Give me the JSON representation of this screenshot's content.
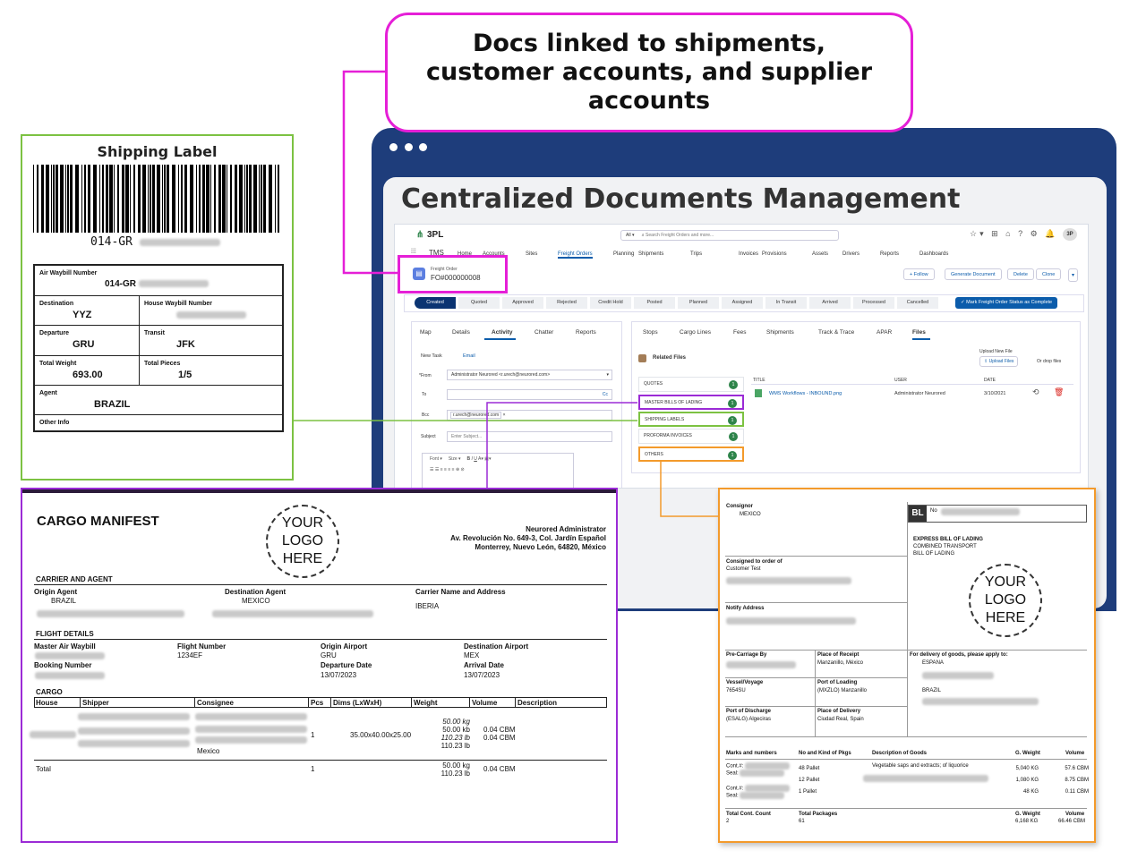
{
  "callout": {
    "text": "Docs linked to shipments, customer accounts, and supplier accounts"
  },
  "main_title": "Centralized Documents Management",
  "app": {
    "brand": "3PL",
    "search_scope": "All",
    "search_placeholder": "Search Freight Orders and more...",
    "nav_app": "TMS",
    "nav": [
      "Home",
      "Accounts",
      "Sites",
      "Freight Orders",
      "Planning",
      "Shipments",
      "Trips",
      "Invoices",
      "Provisions",
      "Assets",
      "Drivers",
      "Reports",
      "Dashboards"
    ],
    "record_type": "Freight Order",
    "record_id": "FO#000000008",
    "actions": [
      "+ Follow",
      "Generate Document",
      "Delete",
      "Clone"
    ],
    "stages": [
      "Created",
      "Quoted",
      "Approved",
      "Rejected",
      "Credit Hold",
      "Posted",
      "Planned",
      "Assigned",
      "In Transit",
      "Arrived",
      "Processed",
      "Cancelled"
    ],
    "complete_button": "Mark Freight Order Status as Complete",
    "left_tabs": [
      "Map",
      "Details",
      "Activity",
      "Chatter",
      "Reports"
    ],
    "sub_tabs": [
      "New Task",
      "Email"
    ],
    "email": {
      "from_label": "From",
      "from_value": "Administrator Neurored <r.urech@neurored.com>",
      "to_label": "To",
      "cc": "Cc",
      "bcc_label": "Bcc",
      "bcc_value": "r.urech@neurored.com",
      "subject_label": "Subject",
      "subject_placeholder": "Enter Subject...",
      "font": "Font",
      "size": "Size"
    },
    "right_tabs": [
      "Stops",
      "Cargo Lines",
      "Fees",
      "Shipments",
      "Track & Trace",
      "APAR",
      "Files"
    ],
    "related_files": "Related Files",
    "upload_label": "Upload New File",
    "upload_button": "Upload Files",
    "drop_text": "Or drop files",
    "folders": [
      {
        "name": "QUOTES",
        "count": "1"
      },
      {
        "name": "MASTER BILLS OF LADING",
        "count": "1"
      },
      {
        "name": "SHIPPING LABELS",
        "count": "1"
      },
      {
        "name": "PROFORMA INVOICES",
        "count": "1"
      },
      {
        "name": "OTHERS",
        "count": "1"
      }
    ],
    "file_headers": [
      "TITLE",
      "USER",
      "DATE"
    ],
    "file_row": {
      "title": "WMS Workflows - INBOUND.png",
      "user": "Administrator Neurored",
      "date": "3/10/2021"
    }
  },
  "shipping_label": {
    "title": "Shipping Label",
    "barcode_text": "014-GR",
    "awb_label": "Air Waybill Number",
    "awb_value": "014-GR",
    "dest_label": "Destination",
    "dest_value": "YYZ",
    "hawb_label": "House Waybill Number",
    "dep_label": "Departure",
    "dep_value": "GRU",
    "transit_label": "Transit",
    "transit_value": "JFK",
    "weight_label": "Total Weight",
    "weight_value": "693.00",
    "pieces_label": "Total Pieces",
    "pieces_value": "1/5",
    "agent_label": "Agent",
    "agent_value": "BRAZIL",
    "other_label": "Other Info"
  },
  "manifest": {
    "title": "CARGO MANIFEST",
    "logo": "YOUR LOGO HERE",
    "company": "Neurored Administrator",
    "address1": "Av. Revolución No. 649-3, Col. Jardín Español",
    "address2": "Monterrey, Nuevo León, 64820, México",
    "carrier_section": "CARRIER AND AGENT",
    "origin_agent_label": "Origin Agent",
    "origin_agent_value": "BRAZIL",
    "dest_agent_label": "Destination Agent",
    "dest_agent_value": "MEXICO",
    "carrier_label": "Carrier Name and Address",
    "carrier_value": "IBERIA",
    "flight_section": "FLIGHT DETAILS",
    "maw_label": "Master Air Waybill",
    "flight_label": "Flight Number",
    "flight_value": "1234EF",
    "origin_airport_label": "Origin Airport",
    "origin_airport_value": "GRU",
    "dest_airport_label": "Destination Airport",
    "dest_airport_value": "MEX",
    "booking_label": "Booking Number",
    "dep_date_label": "Departure Date",
    "dep_date_value": "13/07/2023",
    "arr_date_label": "Arrival Date",
    "arr_date_value": "13/07/2023",
    "cargo_section": "CARGO",
    "cargo_headers": [
      "House",
      "Shipper",
      "Consignee",
      "Pcs",
      "Dims (LxWxH)",
      "Weight",
      "Volume",
      "Description"
    ],
    "row": {
      "pcs": "1",
      "dims": "35.00x40.00x25.00",
      "w1": "50.00 kg",
      "w2": "50.00 kb",
      "w3": "110.23 lb",
      "w4": "110.23 lb",
      "v1": "0.04 CBM",
      "v2": "0.04 CBM",
      "consignee_city": "Mexico"
    },
    "total_label": "Total",
    "total_pcs": "1",
    "total_w1": "50.00 kg",
    "total_w2": "110.23 lb",
    "total_vol": "0.04 CBM"
  },
  "bol": {
    "consignor_label": "Consignor",
    "consignor_value": "MEXICO",
    "bl_mark": "BL",
    "no_label": "No",
    "doc_type1": "EXPRESS BILL OF LADING",
    "doc_type2": "COMBINED TRANSPORT",
    "doc_type3": "BILL OF LADING",
    "consigned_label": "Consigned to order of",
    "consigned_value": "Customer Test",
    "logo": "YOUR LOGO HERE",
    "notify_label": "Notify Address",
    "precarriage_label": "Pre-Carriage By",
    "receipt_label": "Place of Receipt",
    "receipt_value": "Manzanillo, México",
    "delivery_apply_label": "For delivery of goods, please apply to:",
    "delivery_country": "ESPANA",
    "vessel_label": "Vessel/Voyage",
    "vessel_value": "7654SU",
    "loading_label": "Port of Loading",
    "loading_value": "(MXZLO) Manzanillo",
    "brazil": "BRAZIL",
    "discharge_label": "Port of Discharge",
    "discharge_value": "(ESALG) Algeciras",
    "place_delivery_label": "Place of Delivery",
    "place_delivery_value": "Ciudad Real, Spain",
    "goods_headers": [
      "Marks and numbers",
      "No and Kind of Pkgs",
      "Description of Goods",
      "G. Weight",
      "Volume"
    ],
    "cont_label": "Cont.#:",
    "seal_label": "Seal:",
    "pkgs": [
      "48 Pallet",
      "12 Pallet",
      "1 Pallet"
    ],
    "goods_desc": "Vegetable saps and extracts; of liquorice",
    "weights": [
      "5,040 KG",
      "1,080 KG",
      "48 KG"
    ],
    "volumes": [
      "57.6 CBM",
      "8.75 CBM",
      "0.11 CBM"
    ],
    "total_cont_label": "Total Cont. Count",
    "total_cont_value": "2",
    "total_pkgs_label": "Total Packages",
    "total_pkgs_value": "61",
    "total_weight_label": "G. Weight",
    "total_weight_value": "6,168 KG",
    "total_volume_label": "Volume",
    "total_volume_value": "66.46 CBM"
  }
}
